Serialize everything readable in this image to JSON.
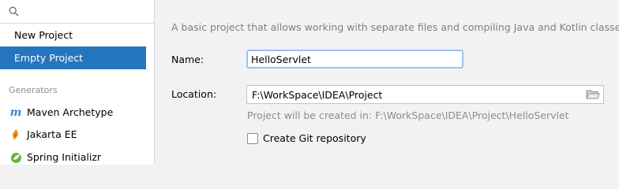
{
  "sidebar": {
    "search_placeholder": "",
    "items": [
      {
        "label": "New Project",
        "selected": false
      },
      {
        "label": "Empty Project",
        "selected": true
      }
    ],
    "generators_label": "Generators",
    "generators": [
      {
        "label": "Maven Archetype",
        "icon": "maven-icon"
      },
      {
        "label": "Jakarta EE",
        "icon": "jakarta-icon"
      },
      {
        "label": "Spring Initializr",
        "icon": "spring-icon"
      }
    ]
  },
  "main": {
    "description": "A basic project that allows working with separate files and compiling Java and Kotlin classes.",
    "name_label": "Name:",
    "name_value": "HelloServlet",
    "location_label": "Location:",
    "location_value": "F:\\WorkSpace\\IDEA\\Project",
    "location_hint": "Project will be created in: F:\\WorkSpace\\IDEA\\Project\\HelloServlet",
    "git_label": "Create Git repository",
    "git_checked": false
  },
  "colors": {
    "selection": "#2675bf",
    "focus_border": "#97c3f0",
    "panel_bg": "#f2f2f2"
  }
}
